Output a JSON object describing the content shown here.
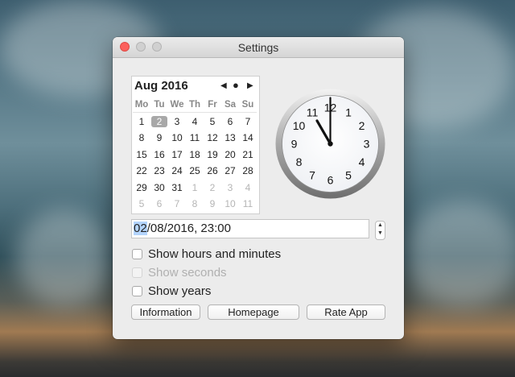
{
  "window": {
    "title": "Settings"
  },
  "calendar": {
    "month_label": "Aug 2016",
    "prev_glyph": "◀",
    "today_glyph": "●",
    "next_glyph": "▶",
    "weekdays": [
      "Mo",
      "Tu",
      "We",
      "Th",
      "Fr",
      "Sa",
      "Su"
    ],
    "weeks": [
      [
        "1",
        "2",
        "3",
        "4",
        "5",
        "6",
        "7"
      ],
      [
        "8",
        "9",
        "10",
        "11",
        "12",
        "13",
        "14"
      ],
      [
        "15",
        "16",
        "17",
        "18",
        "19",
        "20",
        "21"
      ],
      [
        "22",
        "23",
        "24",
        "25",
        "26",
        "27",
        "28"
      ],
      [
        "29",
        "30",
        "31",
        "1",
        "2",
        "3",
        "4"
      ],
      [
        "5",
        "6",
        "7",
        "8",
        "9",
        "10",
        "11"
      ]
    ],
    "selected_day": "2"
  },
  "clock": {
    "numerals": [
      "12",
      "1",
      "2",
      "3",
      "4",
      "5",
      "6",
      "7",
      "8",
      "9",
      "10",
      "11"
    ],
    "hour": 11,
    "minute": 0
  },
  "datetime_field": {
    "selected_part": "02",
    "rest": "/08/2016, 23:00"
  },
  "stepper": {
    "up": "▲",
    "down": "▼"
  },
  "options": [
    {
      "label": "Show hours and minutes",
      "checked": false,
      "enabled": true
    },
    {
      "label": "Show seconds",
      "checked": false,
      "enabled": false
    },
    {
      "label": "Show years",
      "checked": false,
      "enabled": true
    }
  ],
  "buttons": {
    "information": "Information",
    "homepage": "Homepage",
    "rate": "Rate App"
  },
  "colors": {
    "close_button": "#fc605c",
    "selection": "#b3d4fc",
    "selected_day": "#a8a8a8"
  }
}
